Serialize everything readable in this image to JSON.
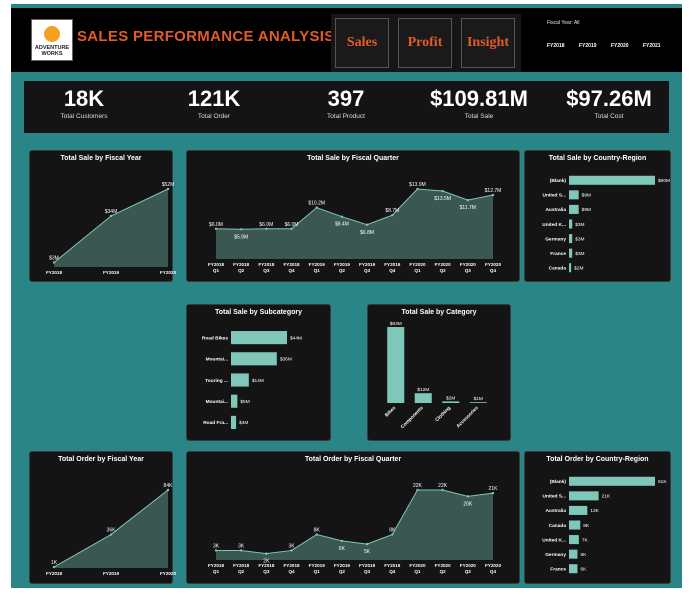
{
  "header": {
    "title": "SALES PERFORMANCE ANALYSIS",
    "logo_text_1": "ADVENTURE",
    "logo_text_2": "WORKS",
    "nav": [
      {
        "label": "Sales"
      },
      {
        "label": "Profit"
      },
      {
        "label": "Insight"
      }
    ],
    "slicer": {
      "label": "Fiscal Year: All",
      "years": [
        "FY2018",
        "FY2019",
        "FY2020",
        "FY2021"
      ]
    }
  },
  "kpis": [
    {
      "value": "18K",
      "label": "Total Customers"
    },
    {
      "value": "121K",
      "label": "Total Order"
    },
    {
      "value": "397",
      "label": "Total Product"
    },
    {
      "value": "$109.81M",
      "label": "Total Sale"
    },
    {
      "value": "$97.26M",
      "label": "Total Cost"
    }
  ],
  "colors": {
    "accent": "#7ec7b9",
    "area": "#3e5e59",
    "canvas": "#2a8686",
    "card": "#141414",
    "title": "#e25b2a"
  },
  "chart_data": [
    {
      "id": "sale_fy",
      "type": "area",
      "title": "Total Sale by Fiscal Year",
      "categories": [
        "FY2018",
        "FY2019",
        "FY2020"
      ],
      "values": [
        3,
        34,
        52
      ],
      "labels": [
        "$3M",
        "$34M",
        "$52M"
      ]
    },
    {
      "id": "sale_fq",
      "type": "area",
      "title": "Total Sale by Fiscal Quarter",
      "categories": [
        [
          "FY2018",
          "Q1"
        ],
        [
          "FY2018",
          "Q2"
        ],
        [
          "FY2018",
          "Q3"
        ],
        [
          "FY2018",
          "Q4"
        ],
        [
          "FY2019",
          "Q1"
        ],
        [
          "FY2019",
          "Q2"
        ],
        [
          "FY2019",
          "Q3"
        ],
        [
          "FY2019",
          "Q4"
        ],
        [
          "FY2020",
          "Q1"
        ],
        [
          "FY2020",
          "Q2"
        ],
        [
          "FY2020",
          "Q3"
        ],
        [
          "FY2020",
          "Q4"
        ]
      ],
      "values": [
        6.0,
        5.9,
        6.0,
        6.0,
        10.2,
        8.4,
        6.8,
        8.7,
        13.9,
        13.5,
        11.7,
        12.7
      ],
      "labels": [
        "$6.0M",
        "$5.9M",
        "$6.0M",
        "$6.0M",
        "$10.2M",
        "$8.4M",
        "$6.8M",
        "$8.7M",
        "$13.9M",
        "$13.5M",
        "$11.7M",
        "$12.7M"
      ]
    },
    {
      "id": "sale_country",
      "type": "bar",
      "orientation": "horizontal",
      "title": "Total Sale by Country-Region",
      "categories": [
        "(Blank)",
        "United S...",
        "Australia",
        "United K...",
        "Germany",
        "France",
        "Canada"
      ],
      "values": [
        80,
        9,
        9,
        3,
        3,
        3,
        2
      ],
      "labels": [
        "$80M",
        "$9M",
        "$9M",
        "$3M",
        "$3M",
        "$3M",
        "$2M"
      ]
    },
    {
      "id": "sale_subcat",
      "type": "bar",
      "orientation": "horizontal",
      "title": "Total Sale by Subcategory",
      "categories": [
        "Road Bikes",
        "Mountai...",
        "Touring ...",
        "Mountai...",
        "Road Fra..."
      ],
      "values": [
        44,
        36,
        14,
        5,
        4
      ],
      "labels": [
        "$44M",
        "$36M",
        "$14M",
        "$5M",
        "$4M"
      ]
    },
    {
      "id": "sale_category",
      "type": "bar",
      "orientation": "vertical",
      "title": "Total Sale by Category",
      "categories": [
        "Bikes",
        "Components",
        "Clothing",
        "Accessories"
      ],
      "values": [
        93,
        12,
        2,
        1
      ],
      "labels": [
        "$93M",
        "$12M",
        "$2M",
        "$1M"
      ]
    },
    {
      "id": "order_fy",
      "type": "area",
      "title": "Total Order by Fiscal Year",
      "categories": [
        "FY2018",
        "FY2019",
        "FY2020"
      ],
      "values": [
        1,
        36,
        84
      ],
      "labels": [
        "1K",
        "36K",
        "84K"
      ]
    },
    {
      "id": "order_fq",
      "type": "area",
      "title": "Total Order by Fiscal Quarter",
      "categories": [
        [
          "FY2018",
          "Q1"
        ],
        [
          "FY2018",
          "Q2"
        ],
        [
          "FY2018",
          "Q3"
        ],
        [
          "FY2018",
          "Q4"
        ],
        [
          "FY2019",
          "Q1"
        ],
        [
          "FY2019",
          "Q2"
        ],
        [
          "FY2019",
          "Q3"
        ],
        [
          "FY2019",
          "Q4"
        ],
        [
          "FY2020",
          "Q1"
        ],
        [
          "FY2020",
          "Q2"
        ],
        [
          "FY2020",
          "Q3"
        ],
        [
          "FY2020",
          "Q4"
        ]
      ],
      "values": [
        3,
        3,
        2,
        3,
        8,
        6,
        5,
        8,
        22,
        22,
        20,
        21
      ],
      "labels": [
        "3K",
        "3K",
        "2K",
        "3K",
        "8K",
        "6K",
        "5K",
        "8K",
        "22K",
        "22K",
        "20K",
        "21K"
      ]
    },
    {
      "id": "order_country",
      "type": "bar",
      "orientation": "horizontal",
      "title": "Total Order by Country-Region",
      "categories": [
        "(Blank)",
        "United S...",
        "Australia",
        "Canada",
        "United K...",
        "Germany",
        "France"
      ],
      "values": [
        61,
        21,
        13,
        8,
        7,
        6,
        6
      ],
      "labels": [
        "61K",
        "21K",
        "13K",
        "8K",
        "7K",
        "6K",
        "6K"
      ]
    }
  ]
}
